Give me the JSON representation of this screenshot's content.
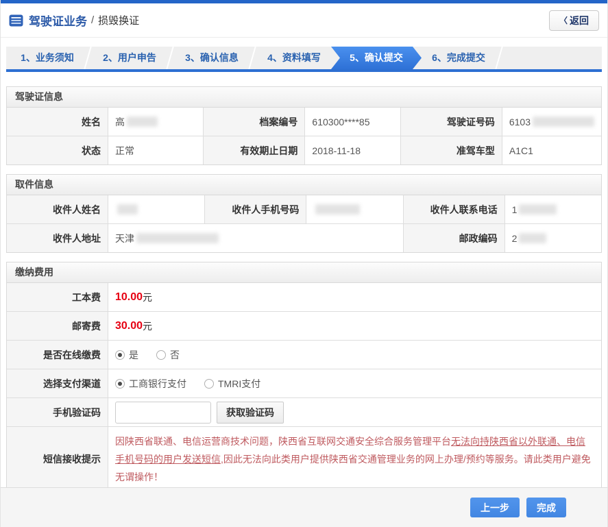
{
  "colors": {
    "topbar_blue": "#2465c8",
    "step_active_blue": "#3b7de2",
    "title_blue": "#2c5aa8",
    "fee_red": "#e60012",
    "notice_red": "#bf5a5f",
    "button_blue": "#4a8ceb"
  },
  "header": {
    "icon": "form-list-icon",
    "title": "驾驶证业务",
    "separator": "/",
    "subtitle": "损毁换证",
    "back_chevron": "〈",
    "back_label": "返回"
  },
  "steps": [
    {
      "label": "1、业务须知",
      "active": false
    },
    {
      "label": "2、用户申告",
      "active": false
    },
    {
      "label": "3、确认信息",
      "active": false
    },
    {
      "label": "4、资料填写",
      "active": false
    },
    {
      "label": "5、确认提交",
      "active": true
    },
    {
      "label": "6、完成提交",
      "active": false
    }
  ],
  "license": {
    "title": "驾驶证信息",
    "name_label": "姓名",
    "name_value": "高",
    "name_masked": true,
    "file_no_label": "档案编号",
    "file_no_value": "610300****85",
    "license_no_label": "驾驶证号码",
    "license_no_value": "6103",
    "license_no_masked": true,
    "status_label": "状态",
    "status_value": "正常",
    "expiry_label": "有效期止日期",
    "expiry_value": "2018-11-18",
    "vehicle_label": "准驾车型",
    "vehicle_value": "A1C1"
  },
  "pickup": {
    "title": "取件信息",
    "recipient_label": "收件人姓名",
    "recipient_value": "",
    "recipient_masked": true,
    "mobile_label": "收件人手机号码",
    "mobile_value": "",
    "mobile_masked": true,
    "phone_label": "收件人联系电话",
    "phone_value": "1",
    "phone_masked": true,
    "address_label": "收件人地址",
    "address_value": "天津",
    "address_masked": true,
    "zip_label": "邮政编码",
    "zip_value": "2",
    "zip_masked": true
  },
  "fees": {
    "title": "缴纳费用",
    "cost_label": "工本费",
    "cost_amount": "10.00",
    "cost_unit": "元",
    "postage_label": "邮寄费",
    "postage_amount": "30.00",
    "postage_unit": "元",
    "online_label": "是否在线缴费",
    "online_yes": "是",
    "online_no": "否",
    "online_selected": "是",
    "channel_label": "选择支付渠道",
    "channel_icbc": "工商银行支付",
    "channel_tmri": "TMRI支付",
    "channel_selected": "工商银行支付",
    "sms_label": "手机验证码",
    "sms_input_value": "",
    "sms_button": "获取验证码",
    "notice_label": "短信接收提示",
    "notice_part1": "因陕西省联通、电信运营商技术问题，陕西省互联网交通安全综合服务管理平台",
    "notice_part2": "无法向持陕西省以外联通、电信手机号码的用户发送短信",
    "notice_part3": ",因此无法向此类用户提供陕西省交通管理业务的网上办理/预约等服务。请此类用户避免无谓操作！"
  },
  "footer": {
    "prev": "上一步",
    "finish": "完成"
  }
}
